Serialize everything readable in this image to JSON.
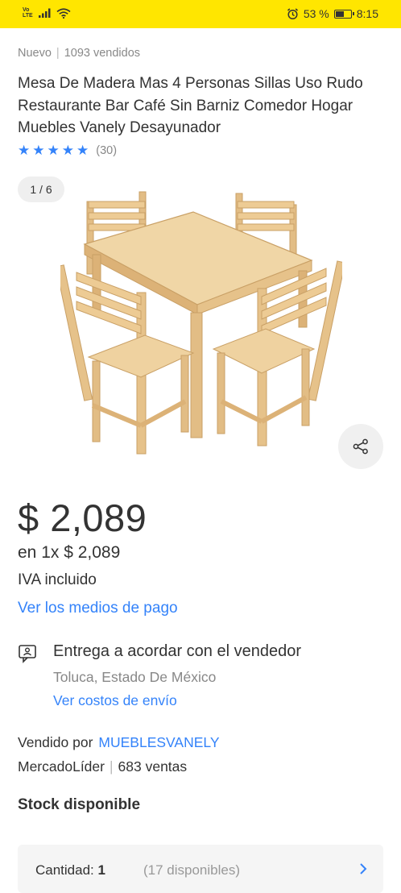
{
  "status_bar": {
    "volte_top": "Vo",
    "volte_bottom": "LTE",
    "battery_percent": "53 %",
    "battery_level": 0.53,
    "time": "8:15"
  },
  "product": {
    "condition": "Nuevo",
    "sold_count": "1093 vendidos",
    "title": "Mesa De Madera Mas 4 Personas Sillas Uso Rudo Restaurante Bar Café Sin Barniz Comedor Hogar Muebles Vanely Desayunador",
    "rating_stars": 5,
    "rating_count": "(30)",
    "image_counter": "1 / 6"
  },
  "price": {
    "amount": "$ 2,089",
    "installments": "en 1x $ 2,089",
    "tax_note": "IVA incluido",
    "payment_link": "Ver los medios de pago"
  },
  "delivery": {
    "title": "Entrega a acordar con el vendedor",
    "location": "Toluca, Estado De México",
    "shipping_link": "Ver costos de envío"
  },
  "seller": {
    "sold_by_label": "Vendido por",
    "name": "MUEBLESVANELY",
    "badge": "MercadoLíder",
    "sales": "683 ventas"
  },
  "stock": {
    "title": "Stock disponible",
    "quantity_label": "Cantidad:",
    "quantity_value": "1",
    "available": "(17 disponibles)"
  },
  "colors": {
    "status_bar": "#ffe600",
    "link_blue": "#3483fa",
    "text_primary": "#333333",
    "text_secondary": "#888888"
  }
}
